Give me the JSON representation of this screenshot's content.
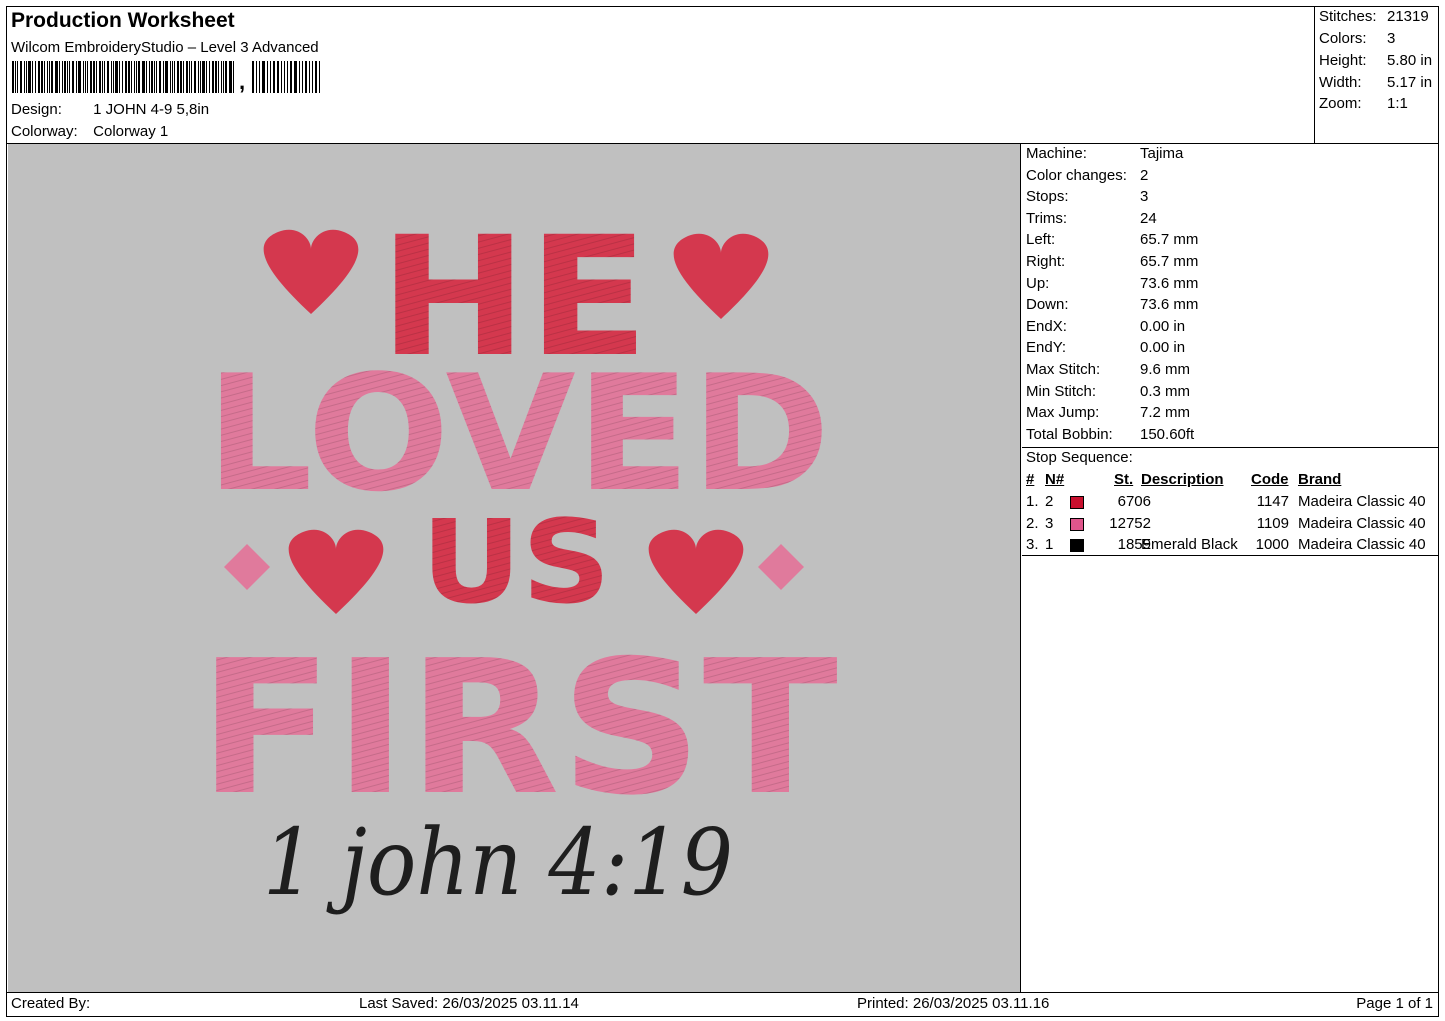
{
  "header": {
    "title": "Production Worksheet",
    "software": "Wilcom EmbroideryStudio – Level 3 Advanced",
    "barcode_suffix": ",",
    "design_label": "Design:",
    "design_value": "1 JOHN 4-9 5,8in",
    "colorway_label": "Colorway:",
    "colorway_value": "Colorway 1"
  },
  "summary": [
    {
      "label": "Stitches:",
      "value": "21319"
    },
    {
      "label": "Colors:",
      "value": "3"
    },
    {
      "label": "Height:",
      "value": "5.80 in"
    },
    {
      "label": "Width:",
      "value": "5.17 in"
    },
    {
      "label": "Zoom:",
      "value": "1:1"
    }
  ],
  "machine_info": [
    {
      "label": "Machine:",
      "value": "Tajima"
    },
    {
      "label": "Color changes:",
      "value": "2"
    },
    {
      "label": "Stops:",
      "value": "3"
    },
    {
      "label": "Trims:",
      "value": "24"
    },
    {
      "label": "Left:",
      "value": "65.7 mm"
    },
    {
      "label": "Right:",
      "value": "65.7 mm"
    },
    {
      "label": "Up:",
      "value": "73.6 mm"
    },
    {
      "label": "Down:",
      "value": "73.6 mm"
    },
    {
      "label": "EndX:",
      "value": "0.00 in"
    },
    {
      "label": "EndY:",
      "value": "0.00 in"
    },
    {
      "label": "Max Stitch:",
      "value": "9.6 mm"
    },
    {
      "label": "Min Stitch:",
      "value": "0.3 mm"
    },
    {
      "label": "Max Jump:",
      "value": "7.2 mm"
    },
    {
      "label": "Total Bobbin:",
      "value": "150.60ft"
    }
  ],
  "stop_sequence": {
    "title": "Stop Sequence:",
    "headers": {
      "num": "#",
      "needle": "N#",
      "stitches": "St.",
      "description": "Description",
      "code": "Code",
      "brand": "Brand"
    },
    "rows": [
      {
        "num": "1.",
        "needle": "2",
        "color": "#c8102e",
        "stitches": "6706",
        "description": "",
        "code": "1147",
        "brand": "Madeira Classic 40"
      },
      {
        "num": "2.",
        "needle": "3",
        "color": "#e0568c",
        "stitches": "12752",
        "description": "",
        "code": "1109",
        "brand": "Madeira Classic 40"
      },
      {
        "num": "3.",
        "needle": "1",
        "color": "#000000",
        "stitches": "1859",
        "description": "Emerald Black",
        "code": "1000",
        "brand": "Madeira Classic 40"
      }
    ]
  },
  "design_preview": {
    "line1": "HE",
    "line2": "LOVED",
    "line3": "US",
    "line4": "FIRST",
    "script": "1 john 4:19",
    "colors": {
      "background": "#c0c0c0",
      "red": "#d4384e",
      "pink": "#e07a9c",
      "black": "#1e1e1e"
    }
  },
  "footer": {
    "created_by": "Created By:",
    "last_saved": "Last Saved: 26/03/2025 03.11.14",
    "printed": "Printed: 26/03/2025 03.11.16",
    "page": "Page 1 of 1"
  }
}
